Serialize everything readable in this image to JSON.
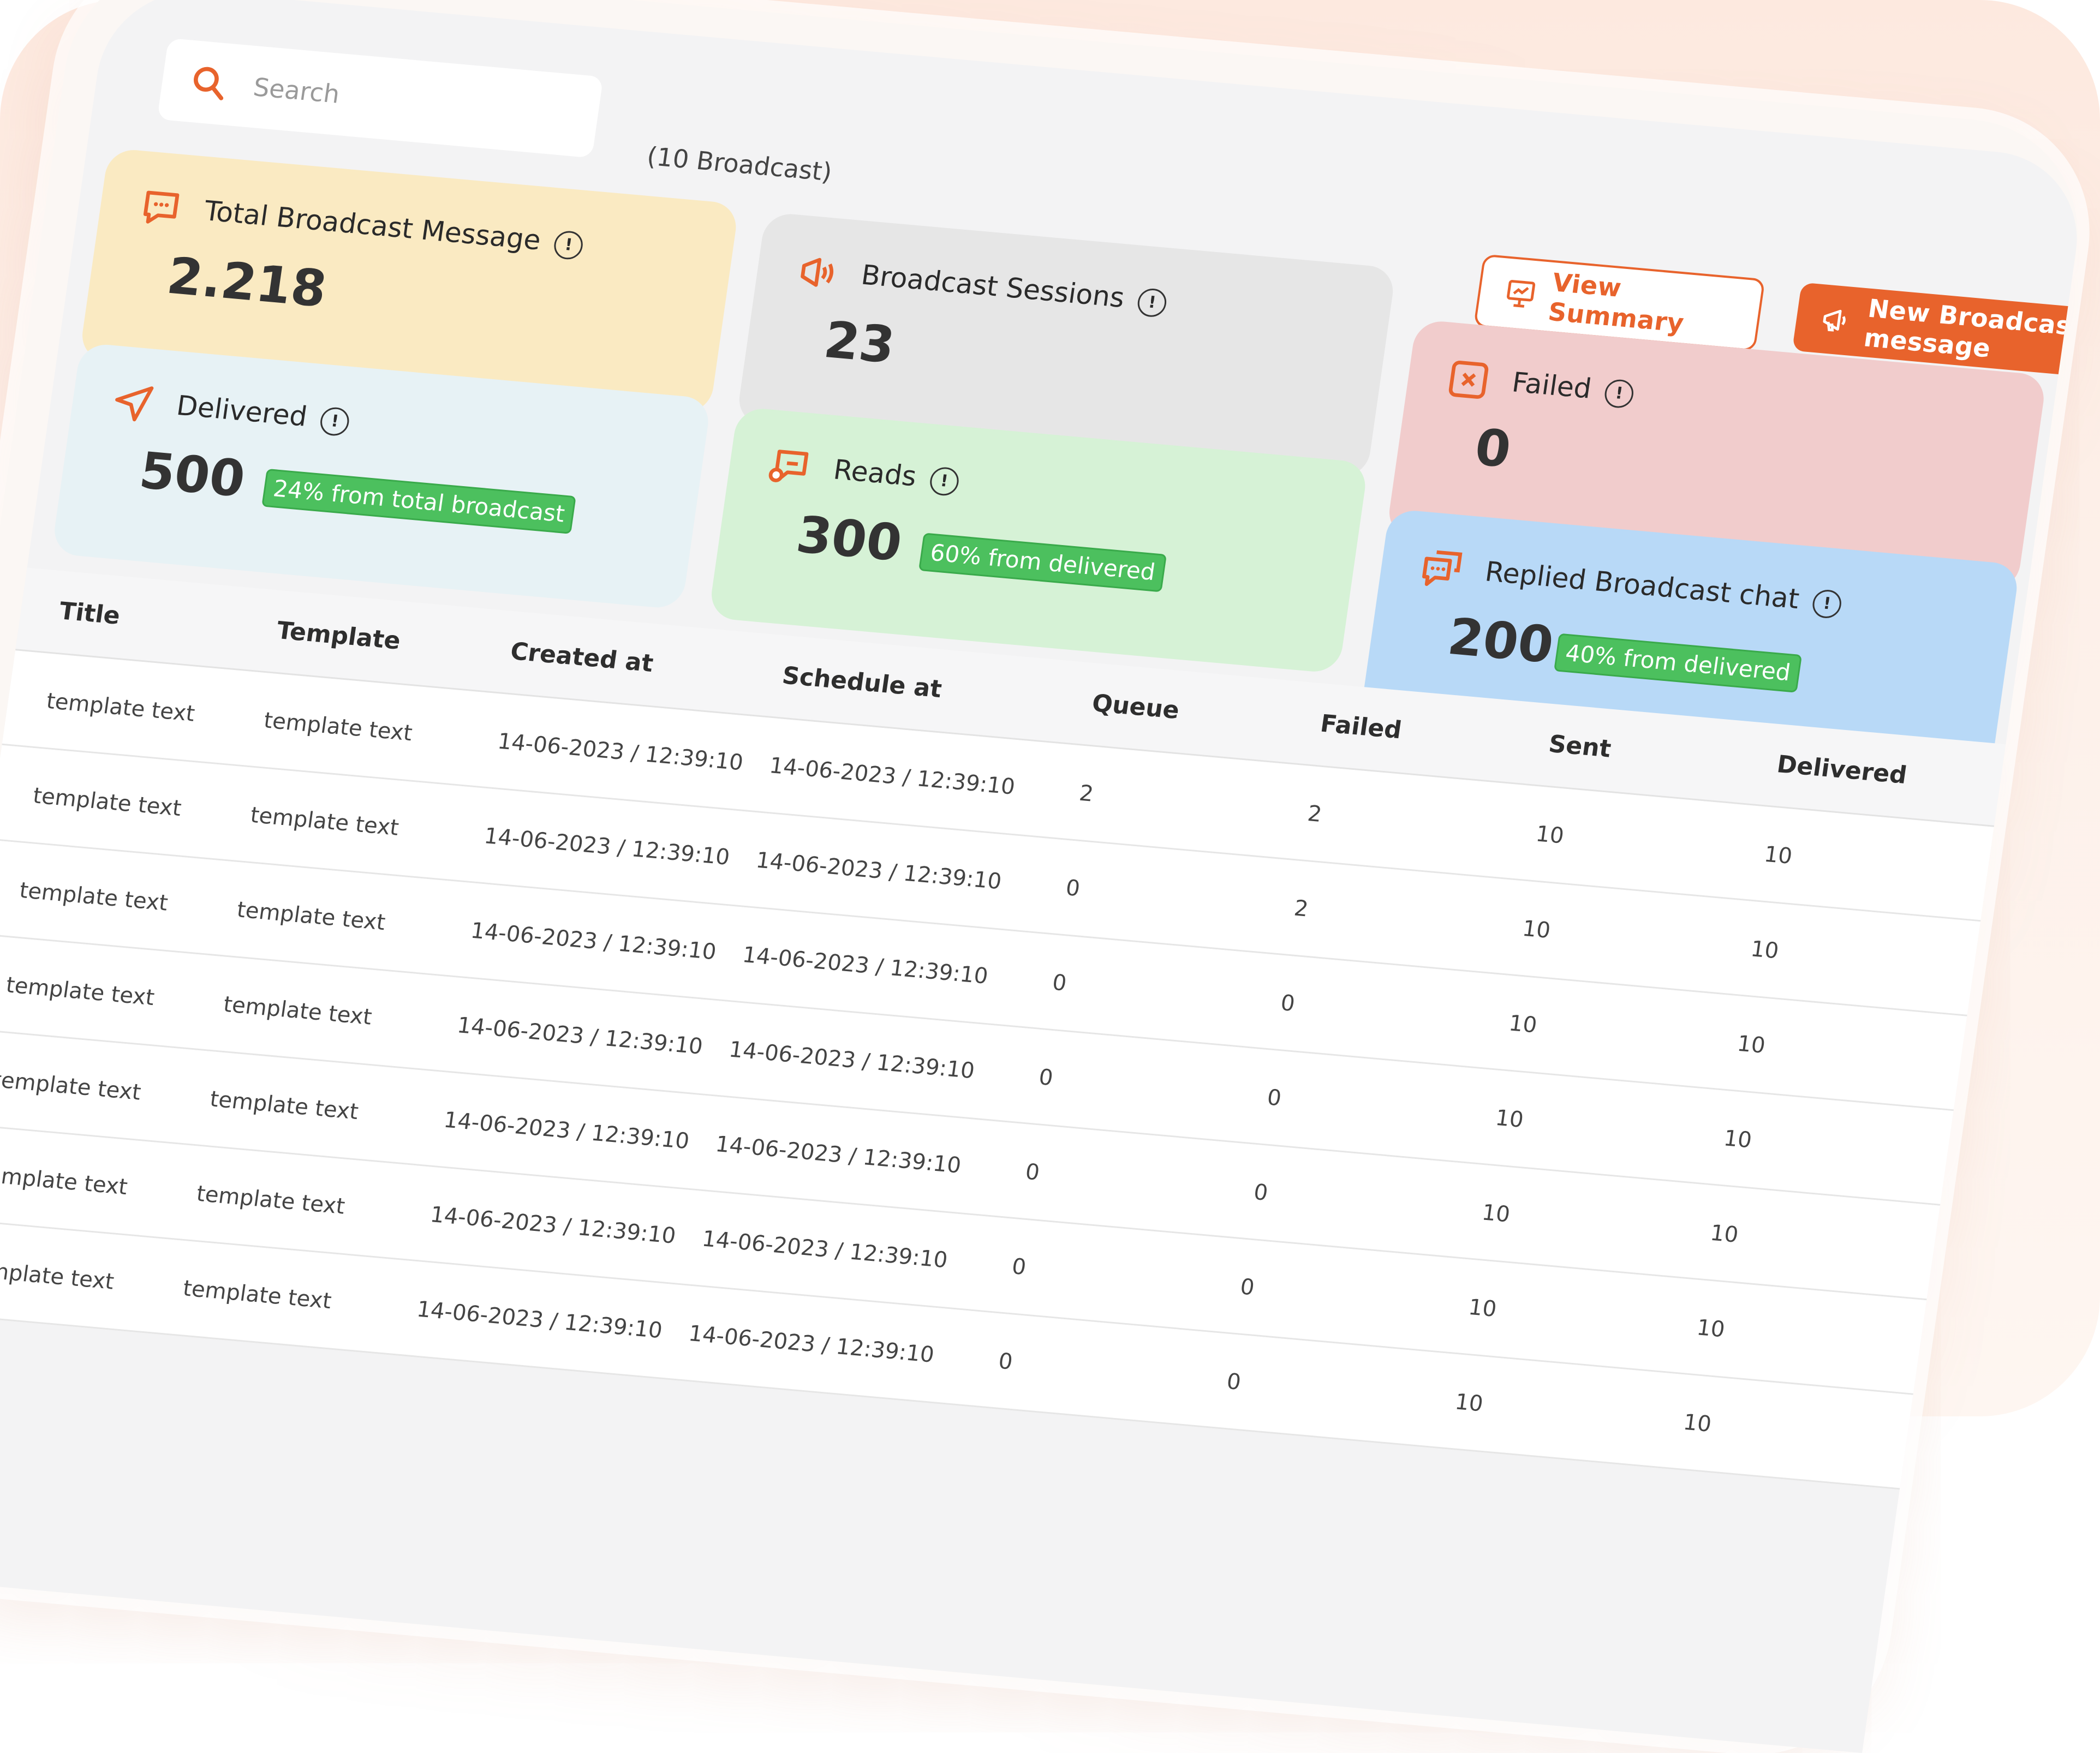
{
  "search": {
    "placeholder": "Search"
  },
  "broadcast_count": "(10 Broadcast)",
  "buttons": {
    "view_summary": "View Summary",
    "new_broadcast": "New Broadcast message"
  },
  "cards": {
    "total": {
      "label": "Total Broadcast Message",
      "value": "2.218"
    },
    "sessions": {
      "label": "Broadcast Sessions",
      "value": "23"
    },
    "delivered": {
      "label": "Delivered",
      "value": "500",
      "badge": "24% from total broadcast"
    },
    "reads": {
      "label": "Reads",
      "value": "300",
      "badge": "60% from delivered"
    },
    "failed": {
      "label": "Failed",
      "value": "0"
    },
    "replied": {
      "label": "Replied Broadcast chat",
      "value": "200",
      "badge": "40% from delivered"
    }
  },
  "info_glyph": "!",
  "table": {
    "headers": [
      "Title",
      "Template",
      "Created at",
      "Schedule at",
      "Queue",
      "Failed",
      "Sent",
      "Delivered"
    ],
    "rows": [
      [
        "template text",
        "template text",
        "14-06-2023 / 12:39:10",
        "14-06-2023 / 12:39:10",
        "2",
        "2",
        "10",
        "10"
      ],
      [
        "template text",
        "template text",
        "14-06-2023 / 12:39:10",
        "14-06-2023 / 12:39:10",
        "0",
        "2",
        "10",
        "10"
      ],
      [
        "template text",
        "template text",
        "14-06-2023 / 12:39:10",
        "14-06-2023 / 12:39:10",
        "0",
        "0",
        "10",
        "10"
      ],
      [
        "template text",
        "template text",
        "14-06-2023 / 12:39:10",
        "14-06-2023 / 12:39:10",
        "0",
        "0",
        "10",
        "10"
      ],
      [
        "template text",
        "template text",
        "14-06-2023 / 12:39:10",
        "14-06-2023 / 12:39:10",
        "0",
        "0",
        "10",
        "10"
      ],
      [
        "template text",
        "template text",
        "14-06-2023 / 12:39:10",
        "14-06-2023 / 12:39:10",
        "0",
        "0",
        "10",
        "10"
      ],
      [
        "template text",
        "template text",
        "14-06-2023 / 12:39:10",
        "14-06-2023 / 12:39:10",
        "0",
        "0",
        "10",
        "10"
      ]
    ]
  },
  "colors": {
    "accent": "#e8632c",
    "badge_green": "#4cc05e"
  }
}
